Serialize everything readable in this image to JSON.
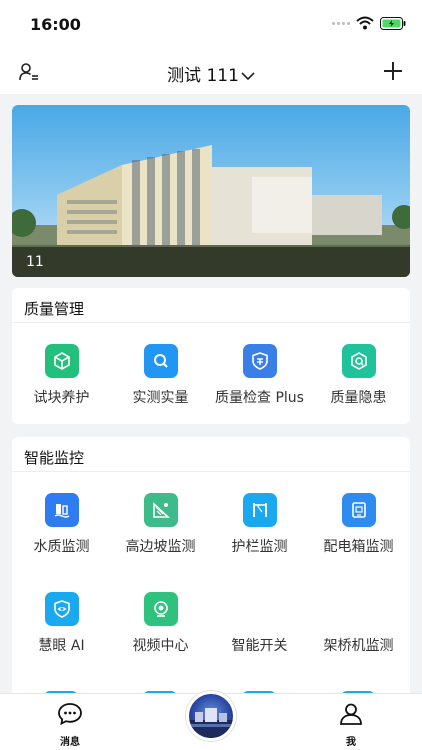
{
  "status": {
    "time": "16:00"
  },
  "nav": {
    "title": "测试 111"
  },
  "banner": {
    "caption": "11"
  },
  "quality": {
    "title": "质量管理",
    "items": [
      {
        "label": "试块养护",
        "icon": "cube-icon",
        "color": "#22c07a"
      },
      {
        "label": "实测实量",
        "icon": "magnifier-icon",
        "color": "#2196f3"
      },
      {
        "label": "质量检查 Plus",
        "icon": "quality-shield-icon",
        "color": "#3a7ee8"
      },
      {
        "label": "质量隐患",
        "icon": "hazard-icon",
        "color": "#1fc29a"
      }
    ]
  },
  "monitor": {
    "title": "智能监控",
    "items": [
      {
        "label": "水质监测",
        "icon": "water-quality-icon",
        "color": "#2f7cf0"
      },
      {
        "label": "高边坡监测",
        "icon": "slope-icon",
        "color": "#3dbb8a"
      },
      {
        "label": "护栏监测",
        "icon": "guardrail-icon",
        "color": "#1aa9f0"
      },
      {
        "label": "配电箱监测",
        "icon": "distribution-box-icon",
        "color": "#2d8cf0"
      },
      {
        "label": "慧眼 AI",
        "icon": "eye-icon",
        "color": "#1aa8ee"
      },
      {
        "label": "视频中心",
        "icon": "camera-icon",
        "color": "#2ec27e"
      },
      {
        "label": "智能开关",
        "icon": "",
        "color": ""
      },
      {
        "label": "架桥机监测",
        "icon": "",
        "color": ""
      }
    ]
  },
  "tabs": {
    "left": "消息",
    "right": "我"
  }
}
